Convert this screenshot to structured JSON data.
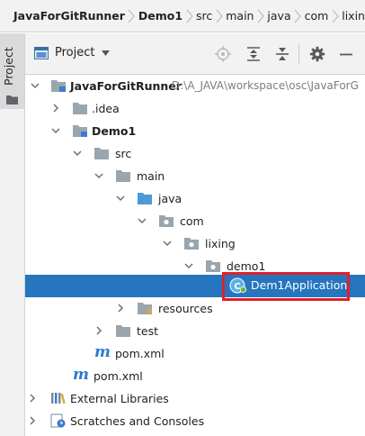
{
  "breadcrumb": [
    "JavaForGitRunner",
    "Demo1",
    "src",
    "main",
    "java",
    "com",
    "lixin"
  ],
  "side_strip": {
    "label": "Project"
  },
  "toolbar": {
    "view_label": "Project"
  },
  "tree": {
    "root": {
      "label": "JavaForGitRunner",
      "path": "D:\\A_JAVA\\workspace\\osc\\JavaForG"
    },
    "idea": {
      "label": ".idea"
    },
    "demo1": {
      "label": "Demo1"
    },
    "src": {
      "label": "src"
    },
    "main": {
      "label": "main"
    },
    "java": {
      "label": "java"
    },
    "com": {
      "label": "com"
    },
    "lixing": {
      "label": "lixing"
    },
    "demo1_pkg": {
      "label": "demo1"
    },
    "dem1app": {
      "label": "Dem1Application"
    },
    "resources": {
      "label": "resources"
    },
    "test": {
      "label": "test"
    },
    "pom_module": {
      "label": "pom.xml"
    },
    "pom_root": {
      "label": "pom.xml"
    },
    "ext_libs": {
      "label": "External Libraries"
    },
    "scratches": {
      "label": "Scratches and Consoles"
    }
  },
  "colors": {
    "selection": "#2675bf",
    "highlight_box": "#e0202a",
    "folder": "#9aa5ad",
    "source_folder": "#4a9ad6",
    "maven": "#2e7ad1"
  }
}
